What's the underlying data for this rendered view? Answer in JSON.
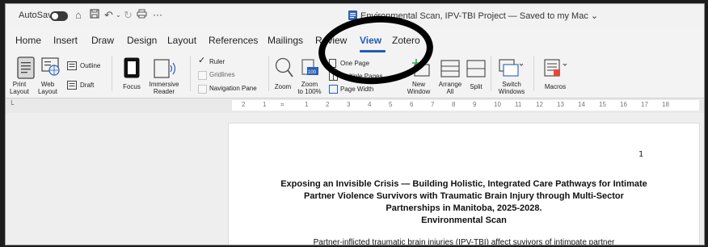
{
  "titlebar": {
    "autosave_label": "AutoSave",
    "doc_title": "Environmental Scan, IPV-TBI Project — Saved to my Mac ⌄",
    "more_glyph": "···"
  },
  "tabs": [
    "Home",
    "Insert",
    "Draw",
    "Design",
    "Layout",
    "References",
    "Mailings",
    "Review",
    "View",
    "Zotero"
  ],
  "active_tab": "View",
  "ribbon": {
    "print_layout": [
      "Print",
      "Layout"
    ],
    "web_layout": [
      "Web",
      "Layout"
    ],
    "outline": "Outline",
    "draft": "Draft",
    "focus": "Focus",
    "immersive_reader": [
      "Immersive",
      "Reader"
    ],
    "ruler": "Ruler",
    "ruler_checked": true,
    "gridlines": "Gridlines",
    "navigation_pane": "Navigation Pane",
    "zoom": "Zoom",
    "zoom_100": [
      "Zoom",
      "to 100%"
    ],
    "zoom_100_icon": "100",
    "one_page": "One Page",
    "multiple_pages": "Multiple Pages",
    "page_width": "Page Width",
    "new_window": [
      "New",
      "Window"
    ],
    "arrange_all": [
      "Arrange",
      "All"
    ],
    "split": "Split",
    "switch_windows": [
      "Switch",
      "Windows"
    ],
    "macros": "Macros"
  },
  "ruler_numbers": [
    "2",
    "1",
    "1",
    "2",
    "3",
    "4",
    "5",
    "6",
    "7",
    "8",
    "9",
    "10",
    "11",
    "12",
    "13",
    "14",
    "15",
    "16",
    "17",
    "18"
  ],
  "document": {
    "page_number": "1",
    "title_lines": [
      "Exposing an Invisible Crisis — Building Holistic, Integrated Care Pathways for Intimate",
      "Partner Violence Survivors with Traumatic Brain Injury through Multi-Sector",
      "Partnerships in Manitoba, 2025-2028.",
      "Environmental Scan"
    ],
    "body_first_line": "Partner-inflicted traumatic brain injuries (IPV-TBI) affect suvivors of intimpate partner"
  },
  "colors": {
    "accent": "#1f5bb5",
    "annotation_circle": "#000000"
  }
}
